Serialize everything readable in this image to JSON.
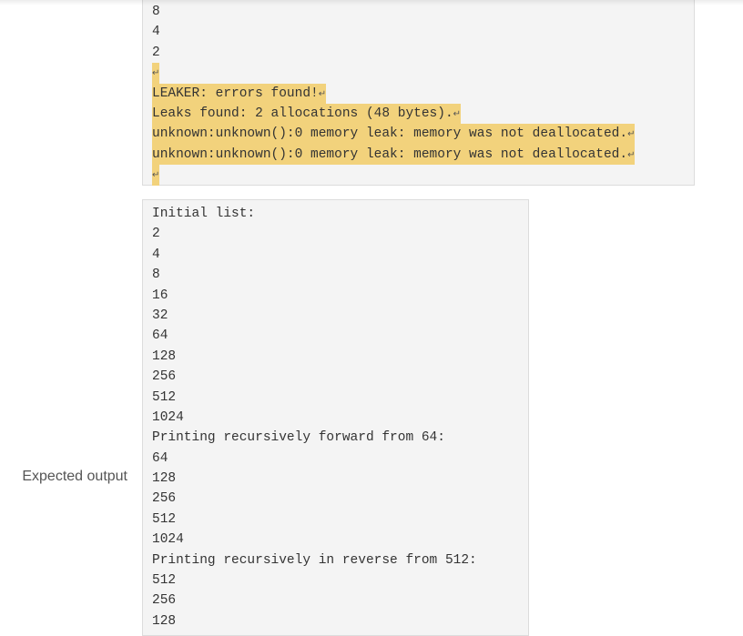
{
  "actual_output_tail": {
    "plain_lines": [
      "8",
      "4",
      "2"
    ],
    "highlighted_lines": [
      "",
      "LEAKER: errors found!",
      "Leaks found: 2 allocations (48 bytes).",
      "unknown:unknown():0 memory leak: memory was not deallocated.",
      "unknown:unknown():0 memory leak: memory was not deallocated.",
      ""
    ],
    "newline_marker": "↵",
    "highlight_color": "#f2d27c"
  },
  "expected_output": {
    "label": "Expected output",
    "lines": [
      "Initial list:",
      "2",
      "4",
      "8",
      "16",
      "32",
      "64",
      "128",
      "256",
      "512",
      "1024",
      "Printing recursively forward from 64:",
      "64",
      "128",
      "256",
      "512",
      "1024",
      "Printing recursively in reverse from 512:",
      "512",
      "256",
      "128"
    ]
  }
}
